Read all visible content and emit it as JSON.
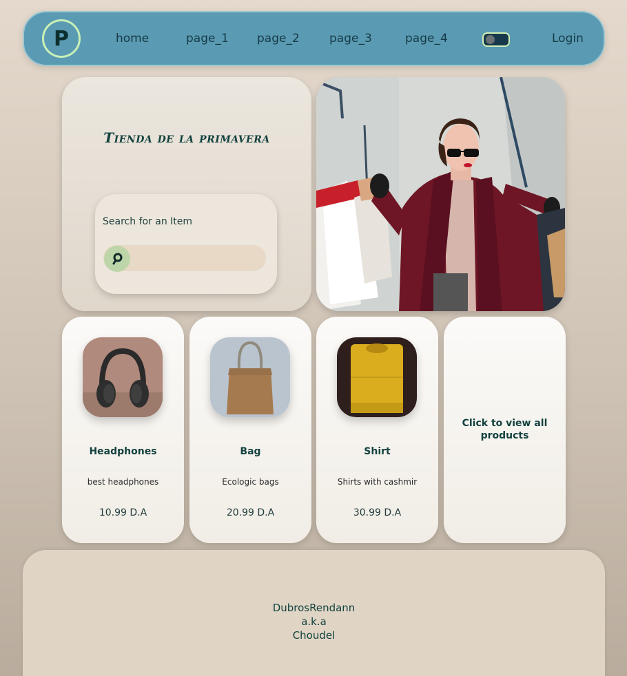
{
  "nav": {
    "logo_letter": "P",
    "links": [
      "home",
      "page_1",
      "page_2",
      "page_3",
      "page_4"
    ],
    "login": "Login"
  },
  "hero": {
    "title": "Tienda de la primavera",
    "search_label": "Search for an Item",
    "search_value": "",
    "image": "woman-shopping-photo"
  },
  "products": [
    {
      "name": "Headphones",
      "description": "best headphones",
      "price": "10.99 D.A",
      "image": "headphones-photo"
    },
    {
      "name": "Bag",
      "description": "Ecologic bags",
      "price": "20.99 D.A",
      "image": "bag-photo"
    },
    {
      "name": "Shirt",
      "description": "Shirts with cashmir",
      "price": "30.99 D.A",
      "image": "shirt-photo"
    }
  ],
  "view_all": "Click to view all products",
  "footer": {
    "line1": "DubrosRendann",
    "line2": "a.k.a",
    "line3": "Choudel"
  },
  "colors": {
    "navbar": "#5a9ab2",
    "accent": "#c8f0b7",
    "text": "#12413e"
  }
}
